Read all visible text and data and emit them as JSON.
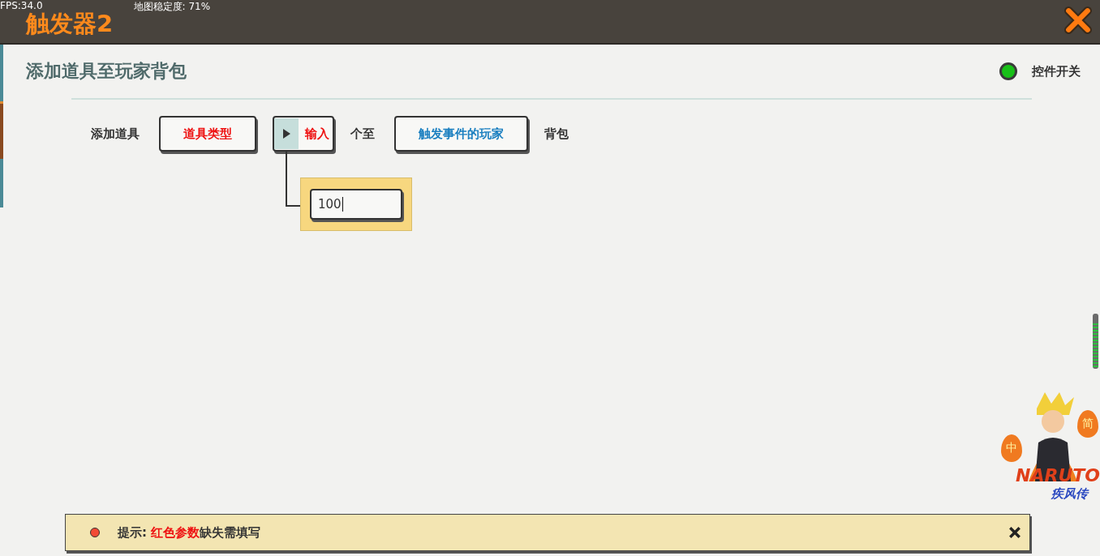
{
  "top_bar": {
    "fps": "FPS:34.0",
    "map_stability": "地图稳定度: 71%",
    "title": "触发器2"
  },
  "panel": {
    "heading": "添加道具至玩家背包",
    "toggle": {
      "label": "控件开关",
      "on": true
    }
  },
  "statement": [
    {
      "kind": "text",
      "text": "添加道具"
    },
    {
      "kind": "param",
      "text": "道具类型",
      "color": "#ee1111"
    },
    {
      "kind": "input",
      "text": "输入",
      "color": "#ee1111",
      "expanded": true
    },
    {
      "kind": "text",
      "text": "个至"
    },
    {
      "kind": "param",
      "text": "触发事件的玩家",
      "color": "#1a7fc0"
    },
    {
      "kind": "text",
      "text": "背包"
    }
  ],
  "input_popup": {
    "value": "100"
  },
  "notice": {
    "prefix": "提示: ",
    "highlight": "红色参数",
    "suffix": "缺失需填写"
  },
  "ime": {
    "mode": "中",
    "layout": "简",
    "logo": "NARUTO",
    "subtitle": "疾风传"
  }
}
